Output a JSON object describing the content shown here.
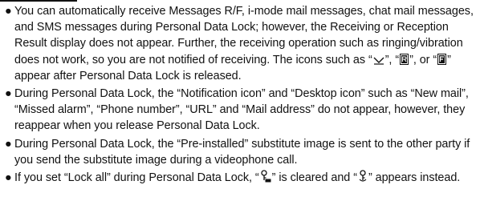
{
  "notes": [
    {
      "parts": [
        "You can automatically receive Messages R/F, i-mode mail messages, chat mail messages, and SMS messages during Personal Data Lock; however, the Receiving or Reception Result display does not appear. Further, the receiving operation such as ringing/vibration does not work, so you are not notified of receiving. The icons such as “",
        "”, “",
        "”, or “",
        "” appear after Personal Data Lock is released."
      ],
      "icons": [
        "mail-envelope-icon",
        "message-r-icon",
        "message-f-icon"
      ]
    },
    {
      "text": "During Personal Data Lock, the “Notification icon” and “Desktop icon” such as “New mail”, “Missed alarm”, “Phone number”, “URL” and “Mail address” do not appear, however, they reappear when you release Personal Data Lock."
    },
    {
      "text": "During Personal Data Lock, the “Pre-installed” substitute image is sent to the other party if you send the substitute image during a videophone call."
    },
    {
      "parts": [
        "If you set “Lock all” during Personal Data Lock, “",
        "” is cleared and “",
        "” appears instead."
      ],
      "icons": [
        "lock-all-key-icon",
        "personal-data-lock-key-icon"
      ]
    }
  ],
  "bullet": "●"
}
